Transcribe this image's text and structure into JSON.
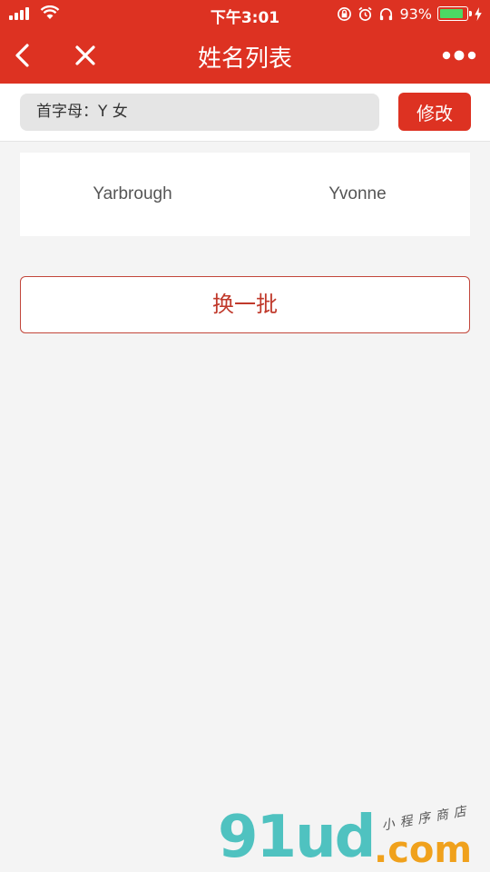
{
  "status_bar": {
    "time": "下午3:01",
    "battery_percent_text": "93%",
    "battery_level": 0.93,
    "icons": [
      "signal-icon",
      "wifi-icon",
      "rotation-lock-icon",
      "alarm-icon",
      "headphones-icon",
      "battery-icon",
      "charging-icon"
    ]
  },
  "nav": {
    "title": "姓名列表",
    "back_icon": "chevron-left-icon",
    "close_icon": "close-icon",
    "more_icon": "more-dots-icon"
  },
  "filter": {
    "label": "首字母：Y 女",
    "edit_label": "修改"
  },
  "names": [
    "Yarbrough",
    "Yvonne"
  ],
  "refresh_label": "换一批",
  "watermark": {
    "main": "91ud",
    "suffix": ".com",
    "tagline": "小程序商店"
  },
  "colors": {
    "brand_red": "#dd3222",
    "background": "#f4f4f4",
    "refresh_text": "#c0392b"
  }
}
